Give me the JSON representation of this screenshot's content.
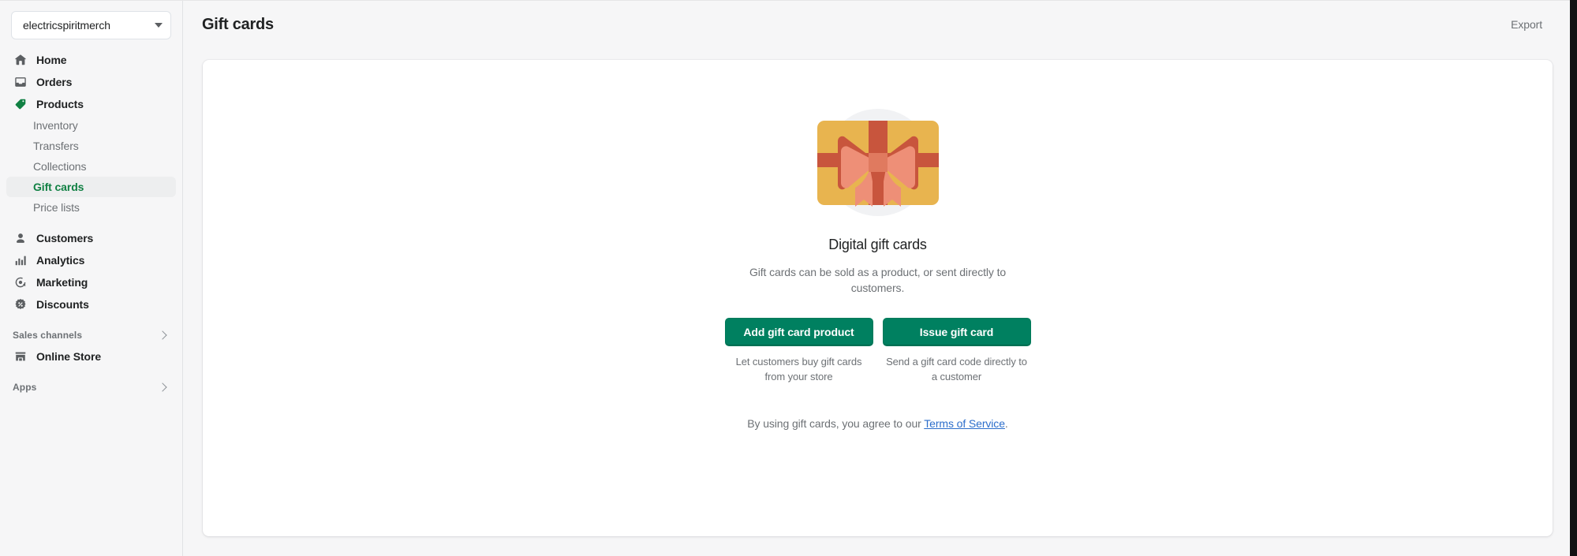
{
  "sidebar": {
    "store_switcher": {
      "name": "electricspiritmerch",
      "caret_icon": "caret-down-icon"
    },
    "primary_items": [
      {
        "label": "Home",
        "icon": "home-icon"
      },
      {
        "label": "Orders",
        "icon": "inbox-icon"
      },
      {
        "label": "Products",
        "icon": "tag-icon",
        "active_parent": true
      }
    ],
    "product_subitems": [
      {
        "label": "Inventory",
        "active": false
      },
      {
        "label": "Transfers",
        "active": false
      },
      {
        "label": "Collections",
        "active": false
      },
      {
        "label": "Gift cards",
        "active": true
      },
      {
        "label": "Price lists",
        "active": false
      }
    ],
    "secondary_items": [
      {
        "label": "Customers",
        "icon": "person-icon"
      },
      {
        "label": "Analytics",
        "icon": "bar-chart-icon"
      },
      {
        "label": "Marketing",
        "icon": "target-icon"
      },
      {
        "label": "Discounts",
        "icon": "discount-badge-icon"
      }
    ],
    "sales_channels": {
      "label": "Sales channels",
      "chevron_icon": "chevron-right-icon",
      "items": [
        {
          "label": "Online Store",
          "icon": "storefront-icon"
        }
      ]
    },
    "apps": {
      "label": "Apps",
      "chevron_icon": "chevron-right-icon"
    }
  },
  "header": {
    "title": "Gift cards",
    "export_label": "Export"
  },
  "empty_state": {
    "illustration": "gift-card-illustration",
    "title": "Digital gift cards",
    "subtitle": "Gift cards can be sold as a product, or sent directly to customers.",
    "primary_actions": [
      {
        "label": "Add gift card product",
        "helper": "Let customers buy gift cards from your store"
      },
      {
        "label": "Issue gift card",
        "helper": "Send a gift card code directly to a customer"
      }
    ],
    "terms": {
      "prefix": "By using gift cards, you agree to our ",
      "link_label": "Terms of Service",
      "suffix": "."
    }
  },
  "colors": {
    "accent_green": "#008060",
    "active_green": "#108043",
    "link_blue": "#2c6ecb",
    "card_yellow": "#e8b44f",
    "ribbon_dark": "#c8553d",
    "ribbon_light": "#ee8f77",
    "page_bg": "#f6f6f7"
  }
}
